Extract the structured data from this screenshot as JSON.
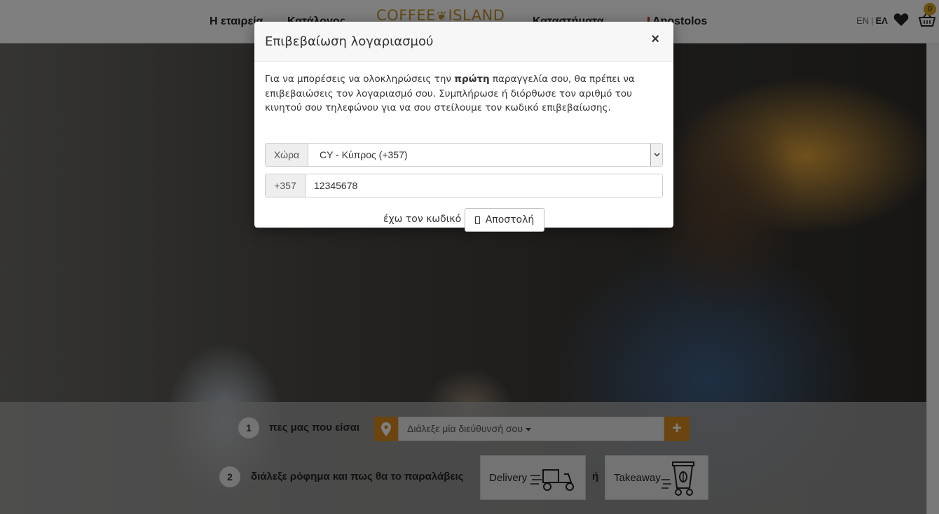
{
  "header": {
    "nav_company": "Η εταιρεία",
    "nav_catalog": "Κατάλογος",
    "logo_left": "COFFEE",
    "logo_right": "ISLAND",
    "nav_stores": "Καταστήματα",
    "nav_user": "Apostolos",
    "lang_en": "EN",
    "lang_el": "ΕΛ",
    "cart_count": "0"
  },
  "modal": {
    "title": "Επιβεβαίωση λογαριασμού",
    "close": "×",
    "intro_before": "Για να μπορέσεις να ολοκληρώσεις την ",
    "intro_bold": "πρώτη",
    "intro_after": " παραγγελία σου, θα πρέπει να επιβεβαιώσεις τον λογαριασμό σου. Συμπλήρωσε ή διόρθωσε τον αριθμό του κινητού σου τηλεφώνου για να σου στείλουμε τον κωδικό επιβεβαίωσης.",
    "country_label": "Χώρα",
    "country_value": "CY - Κύπρος (+357)",
    "phone_prefix": "+357",
    "phone_value": "12345678",
    "have_code": "έχω τον κωδικό",
    "send_label": "Αποστολή"
  },
  "order": {
    "step1_num": "1",
    "step1_text": "πες μας που είσαι",
    "address_placeholder": "Διάλεξε μία διεύθυνσή σου",
    "add_address": "+",
    "step2_num": "2",
    "step2_text": "διάλεξε ρόφημα και πως θα το παραλάβεις",
    "delivery_label": "Delivery",
    "or_text": "ή",
    "takeaway_label": "Takeaway"
  },
  "colors": {
    "accent": "#d7891e",
    "logo": "#c7952a",
    "badge": "#d7a321"
  },
  "icons": [
    "heart-icon",
    "cart-icon",
    "map-pin-icon",
    "phone-icon",
    "scooter-icon",
    "takeaway-cup-icon",
    "chevron-down-icon"
  ]
}
